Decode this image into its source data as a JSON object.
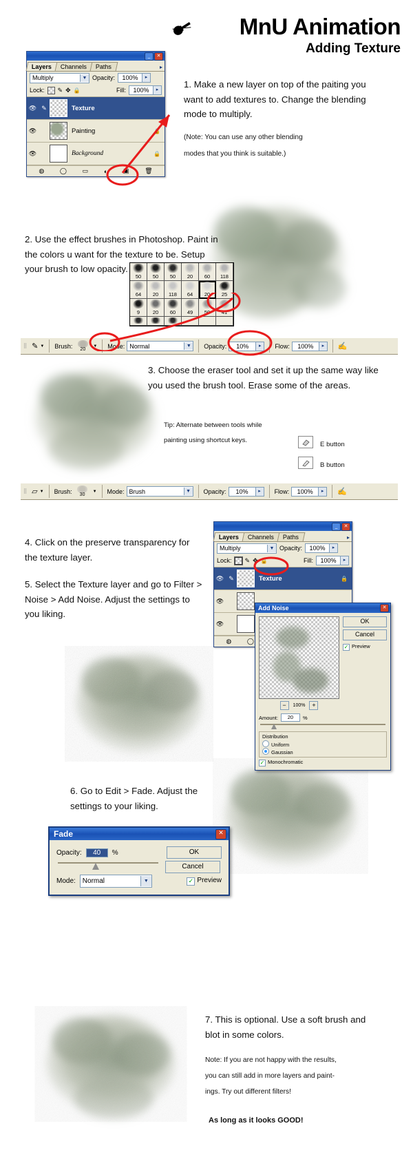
{
  "header": {
    "title": "MnU Animation",
    "subtitle": "Adding Texture",
    "logo_icon": "brush-icon"
  },
  "steps": [
    {
      "id": "step1",
      "text": "1. Make a new layer on top of the paiting you want to add textures to. Change the blending mode to multiply.",
      "note": "(Note: You can use any other blending",
      "note2": "modes that you think is suitable.)"
    },
    {
      "id": "step2",
      "text": "2. Use the effect brushes in Photoshop. Paint in the colors u want for the texture to be. Setup your brush to low opacity."
    },
    {
      "id": "step3",
      "text": "3. Choose the eraser tool and set it up the same way like you used the brush tool. Erase some of the areas.",
      "tip1": "Tip: Alternate between tools while",
      "tip2": "painting using shortcut keys.",
      "key_e": "E button",
      "key_b": "B button"
    },
    {
      "id": "step4",
      "text": "4. Click on the preserve transparency for the texture layer."
    },
    {
      "id": "step5",
      "text": "5. Select the Texture layer and go to Filter > Noise > Add Noise. Adjust the settings to you liking."
    },
    {
      "id": "step6",
      "text": "6. Go to Edit > Fade. Adjust the settings to your liking."
    },
    {
      "id": "step7",
      "text": "7. This is optional. Use a soft brush and blot in some colors.",
      "note1": "Note: If you are not happy with the results,",
      "note2": "you can still add in more layers and paint-",
      "note3": "ings. Try out different filters!",
      "closing": "As long as it looks GOOD!"
    }
  ],
  "layers_panel_1": {
    "tabs": [
      "Layers",
      "Channels",
      "Paths"
    ],
    "active_tab": "Layers",
    "blend_mode": "Multiply",
    "opacity_label": "Opacity:",
    "opacity_value": "100%",
    "lock_label": "Lock:",
    "fill_label": "Fill:",
    "fill_value": "100%",
    "lock_icons": [
      "transparency-lock-icon",
      "paint-lock-icon",
      "move-lock-icon",
      "all-lock-icon"
    ],
    "titlebar_buttons": [
      "minimize-icon",
      "close-icon"
    ],
    "layers": [
      {
        "name": "Texture",
        "selected": true,
        "has_pencil": true,
        "locked": false,
        "thumb": "checker"
      },
      {
        "name": "Painting",
        "selected": false,
        "has_pencil": false,
        "locked": true,
        "thumb": "checker-paint"
      },
      {
        "name": "Background",
        "selected": false,
        "has_pencil": false,
        "locked": true,
        "thumb": "white",
        "italic": true
      }
    ],
    "bottom_icons": [
      "fx-icon",
      "mask-icon",
      "folder-icon",
      "adjustment-icon",
      "new-layer-icon",
      "trash-icon"
    ]
  },
  "layers_panel_2": {
    "tabs": [
      "Layers",
      "Channels",
      "Paths"
    ],
    "active_tab": "Layers",
    "blend_mode": "Multiply",
    "opacity_label": "Opacity:",
    "opacity_value": "100%",
    "lock_label": "Lock:",
    "fill_label": "Fill:",
    "fill_value": "100%",
    "selected_layer": "Texture",
    "highlight_icon": "preserve-transparency-icon"
  },
  "brush_picker": {
    "rows": [
      [
        "50",
        "50",
        "50",
        "20",
        "60",
        "118"
      ],
      [
        "64",
        "20",
        "118",
        "64",
        "20",
        "25"
      ],
      [
        "9",
        "20",
        "60",
        "49",
        "50",
        "41"
      ]
    ],
    "selected_value": "20",
    "selected_row": 1,
    "selected_col": 4
  },
  "brush_options_bar": {
    "tool_icon": "brush-tool-icon",
    "brush_label": "Brush:",
    "brush_size": "20",
    "mode_label": "Mode:",
    "mode_value": "Normal",
    "opacity_label": "Opacity:",
    "opacity_value": "10%",
    "flow_label": "Flow:",
    "flow_value": "100%",
    "airbrush_icon": "airbrush-icon"
  },
  "eraser_options_bar": {
    "tool_icon": "eraser-tool-icon",
    "brush_label": "Brush:",
    "brush_size": "30",
    "mode_label": "Mode:",
    "mode_value": "Brush",
    "opacity_label": "Opacity:",
    "opacity_value": "10%",
    "flow_label": "Flow:",
    "flow_value": "100%",
    "airbrush_icon": "airbrush-icon"
  },
  "add_noise_dialog": {
    "title": "Add Noise",
    "ok": "OK",
    "cancel": "Cancel",
    "preview_label": "Preview",
    "preview_checked": true,
    "zoom_value": "100%",
    "zoom_out_icon": "minus-icon",
    "zoom_in_icon": "plus-icon",
    "amount_label": "Amount:",
    "amount_value": "20",
    "amount_unit": "%",
    "distribution_label": "Distribution",
    "distribution_options": [
      "Uniform",
      "Gaussian"
    ],
    "distribution_selected": "Gaussian",
    "monochromatic_label": "Monochromatic",
    "monochromatic_checked": true
  },
  "fade_dialog": {
    "title": "Fade",
    "opacity_label": "Opacity:",
    "opacity_value": "40",
    "opacity_unit": "%",
    "mode_label": "Mode:",
    "mode_value": "Normal",
    "ok": "OK",
    "cancel": "Cancel",
    "preview_label": "Preview",
    "preview_checked": true,
    "close_icon": "close-icon"
  },
  "colors": {
    "xp_blue": "#1a52b5",
    "panel_face": "#ece9d8",
    "selection_blue": "#31528f",
    "annotation_red": "#e81c1c",
    "paint_green": "#a8b39a"
  }
}
